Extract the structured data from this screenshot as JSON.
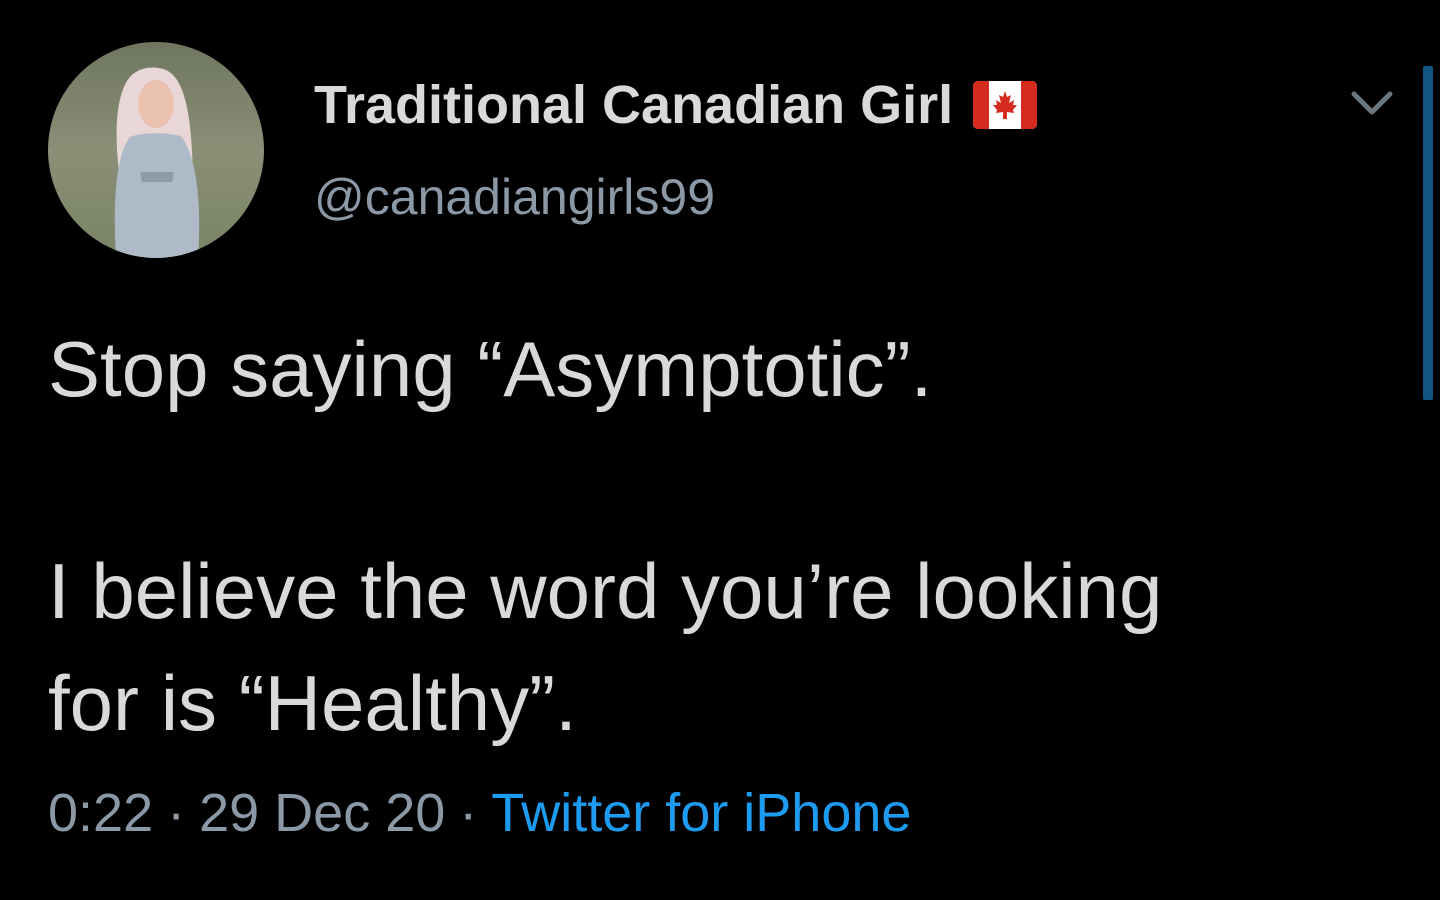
{
  "author": {
    "display_name": "Traditional Canadian Girl",
    "handle": "@canadiangirls99",
    "badge_icon": "canada-flag-icon"
  },
  "tweet": {
    "line1": "Stop saying “Asymptotic”.",
    "line2": "I believe the word you’re looking",
    "line3": "for is “Healthy”."
  },
  "meta": {
    "time": "0:22",
    "separator1": "·",
    "date": "29 Dec 20",
    "separator2": "·",
    "source": "Twitter for iPhone"
  },
  "colors": {
    "background": "#000000",
    "primary_text": "#d9d9d9",
    "secondary_text": "#8b98a5",
    "link": "#1d9bf0",
    "flag_red": "#d52b1e"
  },
  "icons": {
    "menu": "chevron-down-icon"
  }
}
